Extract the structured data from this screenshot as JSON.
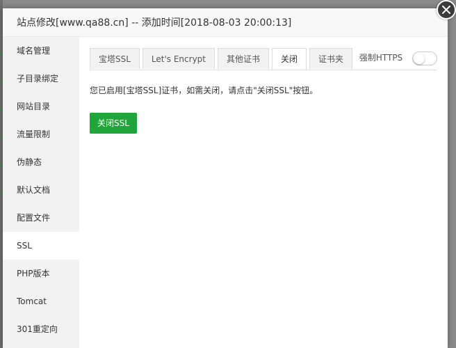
{
  "modal": {
    "title": "站点修改[www.qa88.cn] -- 添加时间[2018-08-03 20:00:13]"
  },
  "sidebar": {
    "items": [
      {
        "label": "域名管理"
      },
      {
        "label": "子目录绑定"
      },
      {
        "label": "网站目录"
      },
      {
        "label": "流量限制"
      },
      {
        "label": "伪静态"
      },
      {
        "label": "默认文档"
      },
      {
        "label": "配置文件"
      },
      {
        "label": "SSL",
        "active": true
      },
      {
        "label": "PHP版本"
      },
      {
        "label": "Tomcat"
      },
      {
        "label": "301重定向"
      }
    ]
  },
  "tabs": [
    {
      "label": "宝塔SSL"
    },
    {
      "label": "Let's Encrypt"
    },
    {
      "label": "其他证书"
    },
    {
      "label": "关闭",
      "active": true
    },
    {
      "label": "证书夹"
    }
  ],
  "force_https": {
    "label": "强制HTTPS",
    "enabled": false
  },
  "content": {
    "message": "您已启用[宝塔SSL]证书，如需关闭，请点击\"关闭SSL\"按钮。",
    "close_button_label": "关闭SSL"
  },
  "colors": {
    "accent_green": "#20a53a",
    "sidebar_bg": "#f2f2f2",
    "overlay": "#8a8a8a"
  }
}
